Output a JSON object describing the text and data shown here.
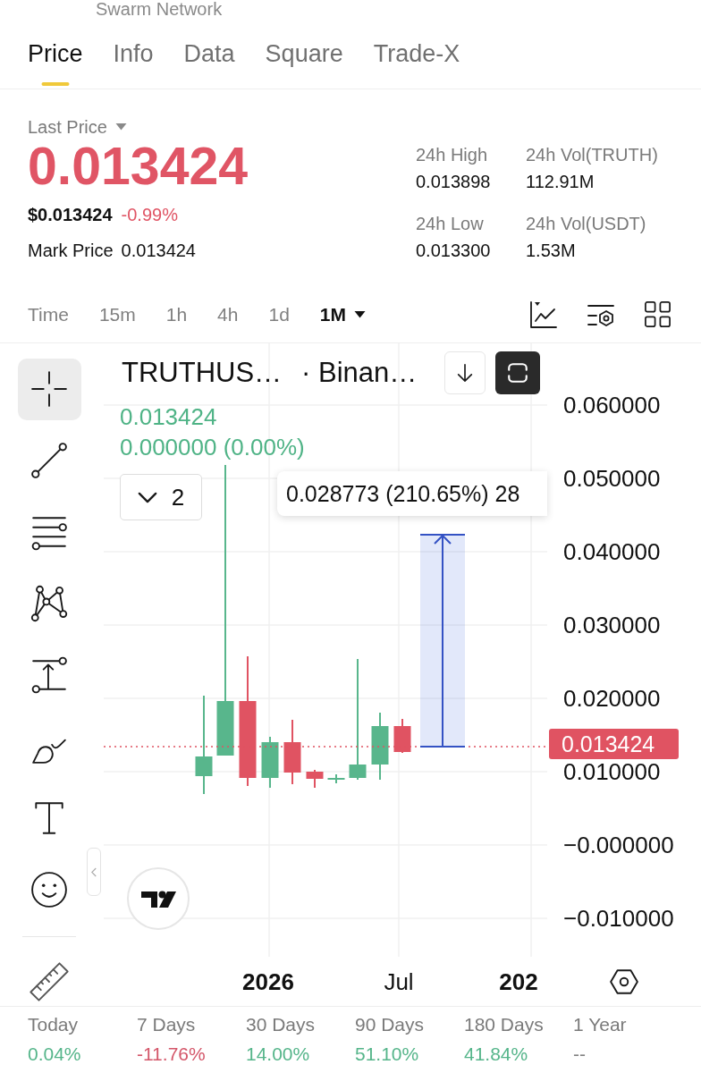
{
  "header": {
    "subtitle": "Swarm Network"
  },
  "tabs": [
    {
      "label": "Price",
      "selected": true
    },
    {
      "label": "Info",
      "selected": false
    },
    {
      "label": "Data",
      "selected": false
    },
    {
      "label": "Square",
      "selected": false
    },
    {
      "label": "Trade-X",
      "selected": false
    }
  ],
  "price": {
    "label": "Last Price",
    "value": "0.013424",
    "falling": true,
    "usd_value": "$0.013424",
    "change": "-0.99%",
    "mark_label": "Mark Price",
    "mark_value": "0.013424"
  },
  "stats": [
    {
      "label": "24h High",
      "value": "0.013898"
    },
    {
      "label": "24h Vol(TRUTH)",
      "value": "112.91M"
    },
    {
      "label": "24h Low",
      "value": "0.013300"
    },
    {
      "label": "24h Vol(USDT)",
      "value": "1.53M"
    }
  ],
  "intervals": [
    {
      "label": "Time",
      "selected": false
    },
    {
      "label": "15m",
      "selected": false
    },
    {
      "label": "1h",
      "selected": false
    },
    {
      "label": "4h",
      "selected": false
    },
    {
      "label": "1d",
      "selected": false
    },
    {
      "label": "1M",
      "selected": true
    }
  ],
  "drawing_tools": [
    {
      "kind": "crosshair",
      "selected": true
    },
    {
      "kind": "trend_line",
      "selected": false
    },
    {
      "kind": "horizontal_lines",
      "selected": false
    },
    {
      "kind": "pattern",
      "selected": false
    },
    {
      "kind": "price_range",
      "selected": false
    },
    {
      "kind": "brush",
      "selected": false
    },
    {
      "kind": "text",
      "selected": false
    },
    {
      "kind": "emoji",
      "selected": false
    }
  ],
  "chart": {
    "symbol": "TRUTHUS…",
    "exchange": "· Binan…",
    "legend_price": "0.013424",
    "legend_change": "0.000000 (0.00%)",
    "legend_rising": true,
    "indicator_count": "2",
    "measure_readout": "0.028773 (210.65%) 28",
    "price_axis": [
      "0.060000",
      "0.050000",
      "0.040000",
      "0.030000",
      "0.020000",
      "0.010000",
      "−0.000000",
      "−0.010000"
    ],
    "current_price": "0.013424",
    "time_axis": [
      {
        "label": "2026",
        "kind": "year"
      },
      {
        "label": "Jul",
        "kind": "month"
      },
      {
        "label": "202",
        "kind": "year"
      }
    ]
  },
  "periods": [
    {
      "label": "Today",
      "value": "0.04%",
      "color": "#55b58a"
    },
    {
      "label": "7 Days",
      "value": "-11.76%",
      "color": "#d4576a"
    },
    {
      "label": "30 Days",
      "value": "14.00%",
      "color": "#55b58a"
    },
    {
      "label": "90 Days",
      "value": "51.10%",
      "color": "#55b58a"
    },
    {
      "label": "180 Days",
      "value": "41.84%",
      "color": "#55b58a"
    },
    {
      "label": "1 Year",
      "value": "--",
      "color": "#808080"
    }
  ]
}
